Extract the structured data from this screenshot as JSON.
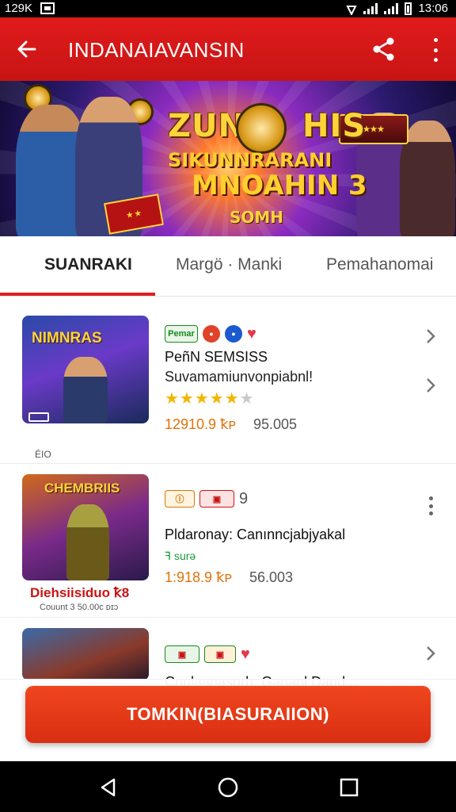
{
  "status_bar": {
    "left_text": "129K",
    "time": "13:06",
    "status_icons": [
      "screenshot-icon",
      "wifi-icon",
      "signal-icon",
      "battery-icon"
    ]
  },
  "app_bar": {
    "title": "INDANAIAVANSIN",
    "back_icon": "arrow-left-icon",
    "share_icon": "share-icon",
    "more_icon": "more-vert-icon"
  },
  "banner": {
    "line1": "ZUN",
    "line1b": "HIS",
    "line2": "SIKUNNRARANI",
    "line3": "MNOAHIN 3",
    "line4": "SOMH"
  },
  "tabs": [
    {
      "label": "SUANRAKI",
      "active": true
    },
    {
      "label": "Margö · Manki",
      "active": false
    },
    {
      "label": "Pemahanomai",
      "active": false
    }
  ],
  "items": [
    {
      "thumb_title": "NIMNRAS",
      "thumb_caption": "ÉIO",
      "badge": "Pemar",
      "title": "PeñN SEMSISS",
      "subtitle": "Suvamamiunvonpiabnl!",
      "rating": 4.5,
      "price_primary": "12910.9 ꝁᴘ",
      "price_secondary": "95.005"
    },
    {
      "thumb_title": "CHEMBRIIS",
      "thumb_footer": "Diehsiisiduo ꝁ8",
      "thumb_caption": "Couunt 3 50.00ᴄ ᴅɪɔ",
      "badge_number": "9",
      "title": "Pldaronay: Canınncjabjyakal",
      "rating_text": "ꟻ surə",
      "price_primary": "1:918.9 ꝁᴘ",
      "price_secondary": "56.003"
    },
    {
      "title": "Cnulaanasurh: Gananl Dand..."
    }
  ],
  "cta": {
    "label": "TOMKIN(BIASURAIION)"
  },
  "colors": {
    "primary": "#d91a1a",
    "accent": "#e0720a",
    "cta": "#e23a18"
  }
}
